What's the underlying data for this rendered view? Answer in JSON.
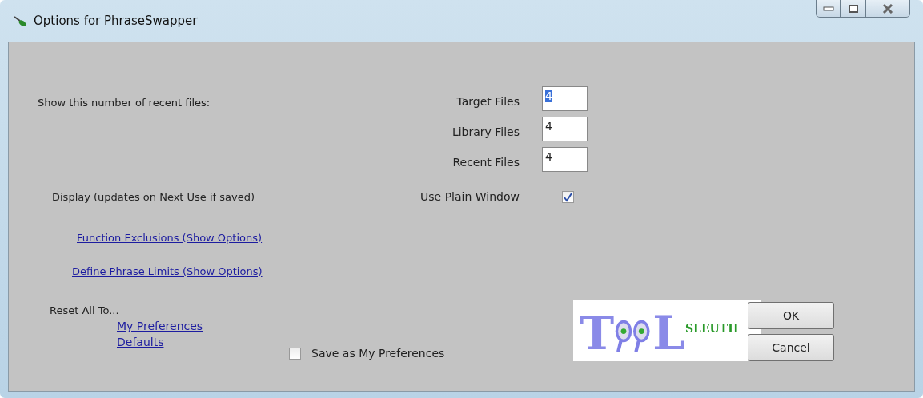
{
  "window": {
    "title": "Options for PhraseSwapper"
  },
  "recent_files": {
    "heading": "Show this number of recent files:",
    "fields": [
      {
        "label": "Target Files",
        "value": "4",
        "selected": true
      },
      {
        "label": "Library Files",
        "value": "4",
        "selected": false
      },
      {
        "label": "Recent Files",
        "value": "4",
        "selected": false
      }
    ]
  },
  "display": {
    "heading": "Display (updates on Next Use if saved)",
    "plain_window": {
      "label": "Use Plain Window",
      "checked": true
    }
  },
  "links": [
    "Function Exclusions (Show Options)",
    "Define Phrase Limits (Show Options)"
  ],
  "reset": {
    "heading": "Reset All To...",
    "links": [
      "My Preferences",
      "Defaults"
    ]
  },
  "save_preferences": {
    "label": "Save as My Preferences",
    "checked": false
  },
  "logo": {
    "letters": [
      "T",
      "L"
    ],
    "word": "SLEUTH"
  },
  "buttons": [
    "OK",
    "Cancel"
  ]
}
